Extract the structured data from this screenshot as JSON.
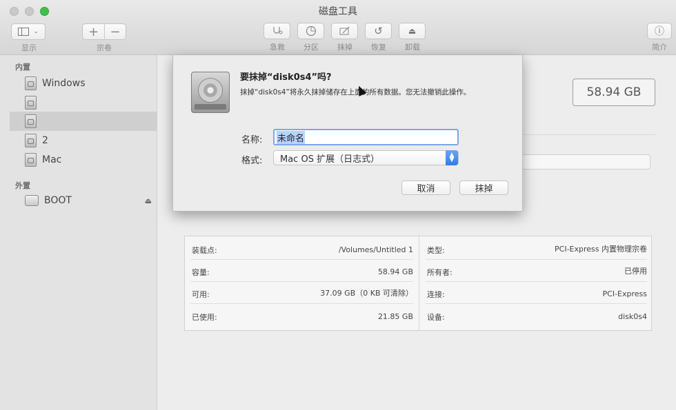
{
  "window": {
    "title": "磁盘工具"
  },
  "toolbar": {
    "view_label": "显示",
    "volume_label": "宗卷",
    "firstaid_label": "急救",
    "partition_label": "分区",
    "erase_label": "抹掉",
    "restore_label": "恢复",
    "unmount_label": "卸载",
    "info_label": "简介"
  },
  "sidebar": {
    "internal_header": "内置",
    "external_header": "外置",
    "internal_items": [
      "Windows",
      "",
      "",
      "2",
      "Mac"
    ],
    "external_items": [
      "BOOT"
    ]
  },
  "main": {
    "capacity_display": "58.94 GB",
    "info_left": [
      {
        "key": "装载点:",
        "value": "/Volumes/Untitled 1"
      },
      {
        "key": "容量:",
        "value": "58.94 GB"
      },
      {
        "key": "可用:",
        "value": "37.09 GB（0 KB 可清除）"
      },
      {
        "key": "已使用:",
        "value": "21.85 GB"
      }
    ],
    "info_right": [
      {
        "key": "类型:",
        "value": "PCI-Express 内置物理宗卷"
      },
      {
        "key": "所有者:",
        "value": "已停用"
      },
      {
        "key": "连接:",
        "value": "PCI-Express"
      },
      {
        "key": "设备:",
        "value": "disk0s4"
      }
    ]
  },
  "dialog": {
    "title": "要抹掉“disk0s4”吗?",
    "message": "抹掉“disk0s4”将永久抹掉储存在上面的所有数据。您无法撤销此操作。",
    "name_label": "名称:",
    "name_value": "未命名",
    "format_label": "格式:",
    "format_value": "Mac OS 扩展（日志式）",
    "cancel_label": "取消",
    "erase_label": "抹掉"
  },
  "colors": {
    "accent": "#2f7de8",
    "selection": "#b5d3ff",
    "zoom": "#3fbf4a"
  }
}
